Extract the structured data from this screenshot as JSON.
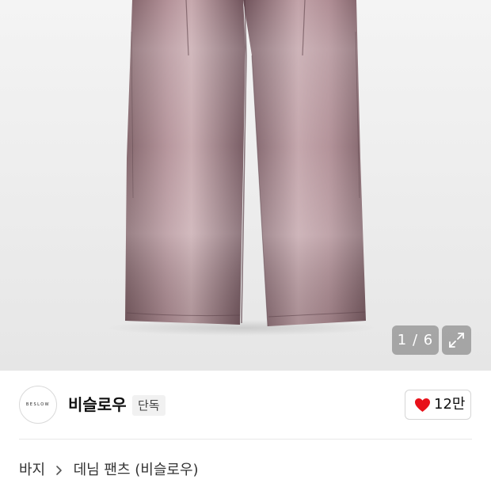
{
  "gallery": {
    "counter": "1 / 6",
    "image_alt": "denim pants product photo"
  },
  "brand": {
    "logo_text": "BESLOW",
    "name": "비슬로우",
    "badge": "단독"
  },
  "like": {
    "count": "12만",
    "icon": "heart-icon",
    "color": "#e8111a"
  },
  "breadcrumb": {
    "items": [
      "바지",
      "데님 팬츠 (비슬로우)"
    ],
    "separator_icon": "chevron-right-icon"
  }
}
